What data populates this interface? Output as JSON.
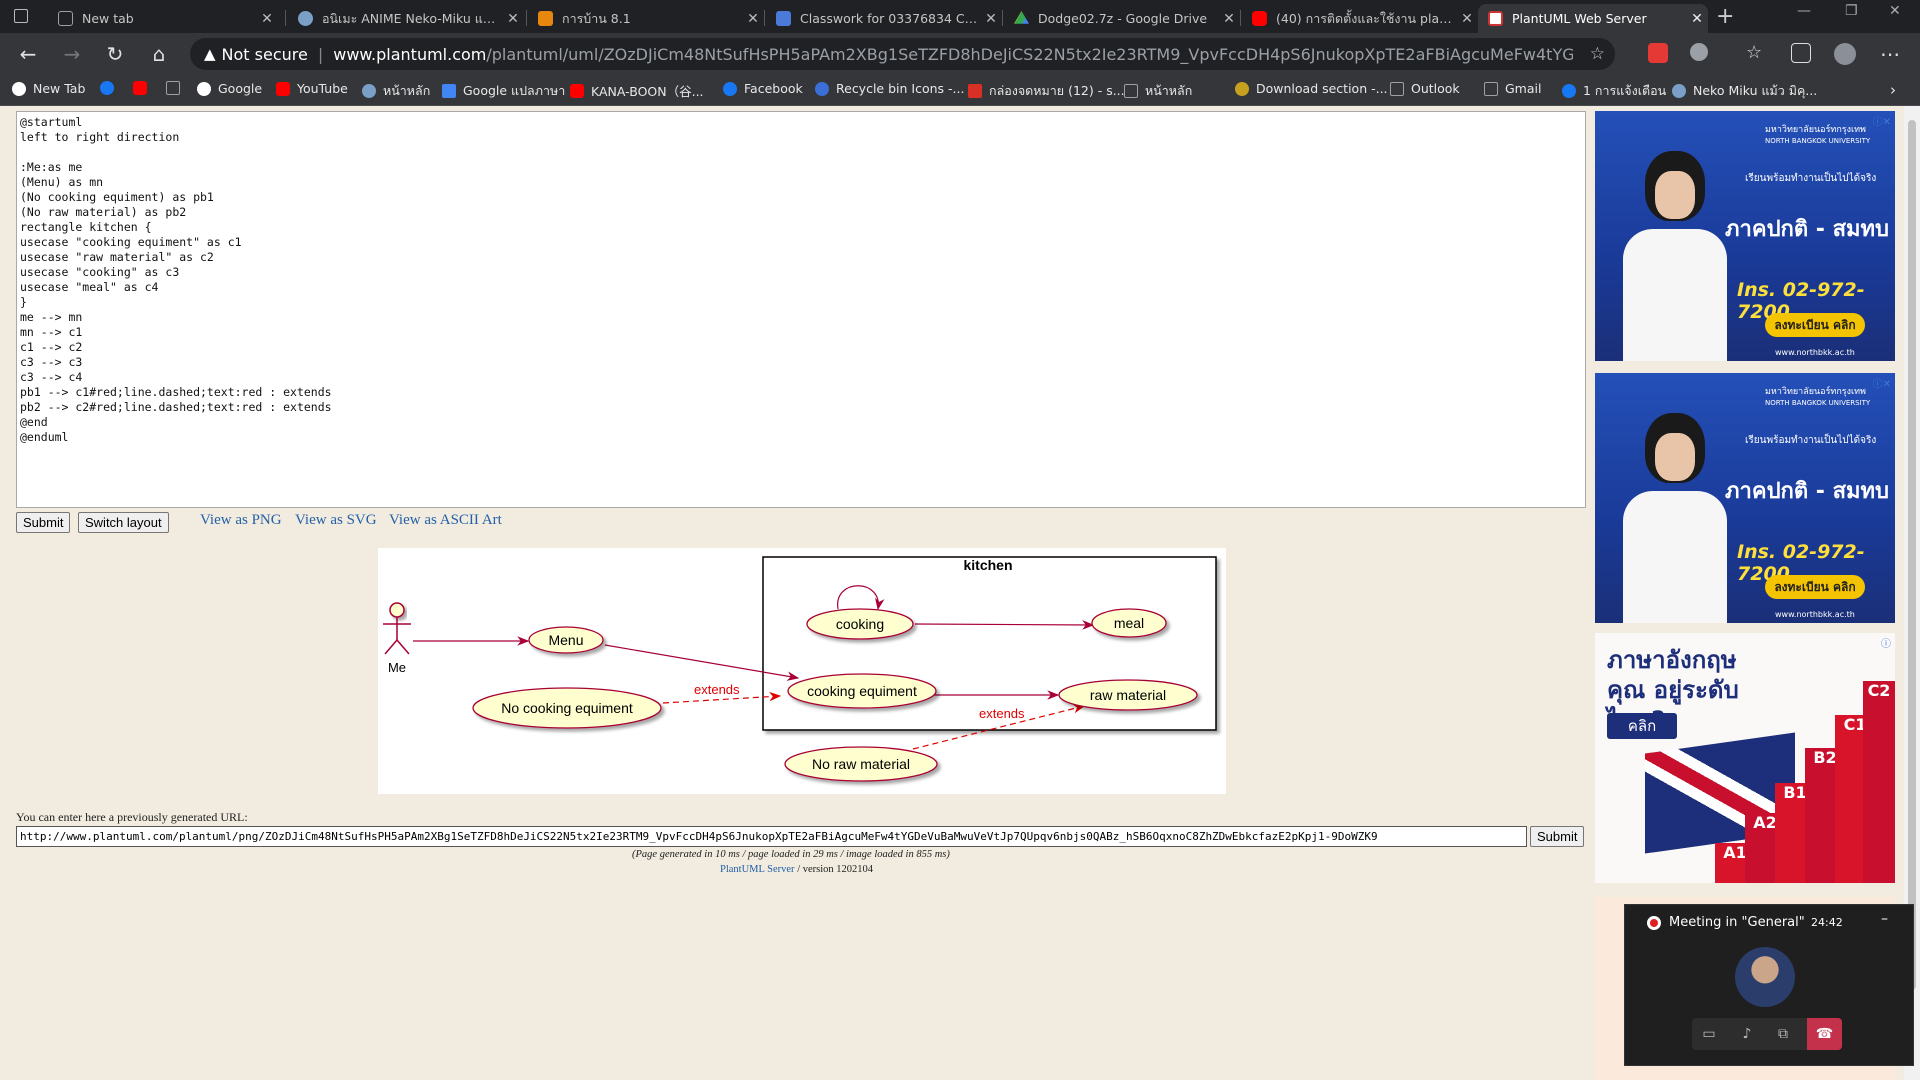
{
  "browser": {
    "tabs": [
      {
        "title": "New tab",
        "icon": "page-icon",
        "color": "#9aa0a6"
      },
      {
        "title": "อนิเมะ ANIME Neko-Miku แม้ว มิ",
        "icon": "globe-icon",
        "color": "#7aa0c8"
      },
      {
        "title": "การบ้าน 8.1",
        "icon": "classroom-icon",
        "color": "#e8870e"
      },
      {
        "title": "Classwork for 03376834 Compu",
        "icon": "classroom-icon",
        "color": "#4a7bd8"
      },
      {
        "title": "Dodge02.7z - Google Drive",
        "icon": "drive-icon",
        "color": "#34a853"
      },
      {
        "title": "(40) การติดตั้งและใช้งาน plantuml",
        "icon": "youtube-icon",
        "color": "#ff0000"
      },
      {
        "title": "PlantUML Web Server",
        "icon": "plantuml-icon",
        "color": "#d44"
      }
    ],
    "new_tab": "+",
    "omnibox": {
      "security": "Not secure",
      "host": "www.plantuml.com",
      "path": "/plantuml/uml/ZOzDJiCm48NtSufHsPH5aPAm2XBg1SeTZFD8hDeJiCS22N5tx2Ie23RTM9_VpvFccDH4pS6JnukopXpTE2aFBiAgcuMeFw4tYGDeVuBaMwuVeVtJp..."
    },
    "bookmarks": [
      {
        "label": "New Tab",
        "color": "#fff"
      },
      {
        "label": "",
        "color": "#1877f2"
      },
      {
        "label": "",
        "color": "#ff0000"
      },
      {
        "label": "",
        "color": "#9aa0a6"
      },
      {
        "label": "Google",
        "color": "#fff"
      },
      {
        "label": "YouTube",
        "color": "#ff0000"
      },
      {
        "label": "หน้าหลัก",
        "color": "#7aa0c8"
      },
      {
        "label": "Google แปลภาษา",
        "color": "#4285f4"
      },
      {
        "label": "KANA-BOON（谷...",
        "color": "#ff0000"
      },
      {
        "label": "Facebook",
        "color": "#1877f2"
      },
      {
        "label": "Recycle bin Icons -...",
        "color": "#3b6fd8"
      },
      {
        "label": "กล่องจดหมาย (12) - s...",
        "color": "#d93025"
      },
      {
        "label": "หน้าหลัก",
        "color": "#9aa0a6"
      },
      {
        "label": "Download section -...",
        "color": "#c8a020"
      },
      {
        "label": "Outlook",
        "color": "#9aa0a6"
      },
      {
        "label": "Gmail",
        "color": "#9aa0a6"
      },
      {
        "label": "1 การแจ้งเตือน",
        "color": "#1877f2"
      },
      {
        "label": "Neko Miku แม้ว มิคุ...",
        "color": "#7aa0c8"
      }
    ]
  },
  "page": {
    "source": "@startuml\nleft to right direction\n\n:Me:as me\n(Menu) as mn\n(No cooking equiment) as pb1\n(No raw material) as pb2\nrectangle kitchen {\nusecase \"cooking equiment\" as c1\nusecase \"raw material\" as c2\nusecase \"cooking\" as c3\nusecase \"meal\" as c4\n}\nme --> mn\nmn --> c1\nc1 --> c2\nc3 --> c3\nc3 --> c4\npb1 --> c1#red;line.dashed;text:red : extends\npb2 --> c2#red;line.dashed;text:red : extends\n@end\n@enduml",
    "submit_label": "Submit",
    "switch_label": "Switch layout",
    "view_links": [
      "View as PNG",
      "View as SVG",
      "View as ASCII Art"
    ],
    "url_prompt": "You can enter here a previously generated URL:",
    "url_value": "http://www.plantuml.com/plantuml/png/ZOzDJiCm48NtSufHsPH5aPAm2XBg1SeTZFD8hDeJiCS22N5tx2Ie23RTM9_VpvFccDH4pS6JnukopXpTE2aFBiAgcuMeFw4tYGDeVuBaMwuVeVtJp7QUpqv6nbjs0QABz_hSB6OqxnoC8ZhZDwEbkcfazE2pKpj1-9DoWZK9",
    "url_submit": "Submit",
    "stats": "(Page generated in 10 ms / page loaded in 29 ms / image loaded in 855 ms)",
    "server_link": "PlantUML Server",
    "version": " / version 1202104"
  },
  "diagram": {
    "actor": "Me",
    "container": "kitchen",
    "usecases": {
      "menu": "Menu",
      "no_cooking": "No cooking equiment",
      "cooking": "cooking",
      "meal": "meal",
      "cooking_equipment": "cooking equiment",
      "raw_material": "raw material",
      "no_raw": "No raw material"
    },
    "extends": "extends",
    "colors": {
      "usecase_fill": "#fefece",
      "usecase_stroke": "#a80036",
      "arrow": "#a80036",
      "extends": "#e00000"
    }
  },
  "ads": {
    "nbu": {
      "uni_th": "มหาวิทยาลัยนอร์ทกรุงเทพ",
      "uni_en": "NORTH BANGKOK UNIVERSITY",
      "headline": "เรียนพร้อมทำงานเป็นไปได้จริง",
      "program": "ภาคปกติ - สมทบ",
      "tel": "Ins. 02-972-7200",
      "cta": "ลงทะเบียน คลิก",
      "site": "www.northbkk.ac.th"
    },
    "english": {
      "question": "ภาษาอังกฤษคุณ อยู่ระดับไหน?",
      "cta": "คลิก",
      "levels": [
        "A1",
        "A2",
        "B1",
        "B2",
        "C1",
        "C2"
      ]
    }
  },
  "meeting": {
    "title": "Meeting in \"General\"",
    "time": "24:42"
  }
}
